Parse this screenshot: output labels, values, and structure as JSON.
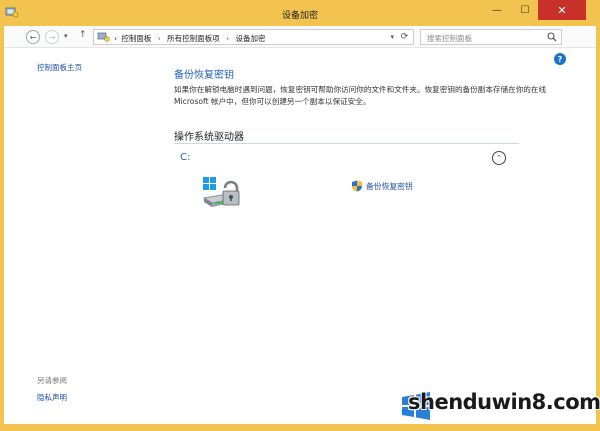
{
  "window": {
    "title": "设备加密",
    "minimize_glyph": "—",
    "maximize_glyph": "☐",
    "close_glyph": "✕"
  },
  "nav": {
    "back_glyph": "←",
    "forward_glyph": "→",
    "history_glyph": "▾",
    "up_glyph": "↑",
    "breadcrumbs": [
      "控制面板",
      "所有控制面板项",
      "设备加密"
    ],
    "crumb_separator": "›",
    "dropdown_glyph": "▾",
    "refresh_glyph": "⟳",
    "search_placeholder": "搜索控制面板"
  },
  "sidebar": {
    "home_link": "控制面板主页",
    "see_also_label": "另请参阅",
    "privacy_link": "隐私声明"
  },
  "main": {
    "help_glyph": "?",
    "title": "备份恢复密钥",
    "description": "如果你在解锁电脑时遇到问题，恢复密钥可帮助你访问你的文件和文件夹。恢复密钥的备份副本存储在你的在线 Microsoft 帐户中，但你可以创建另一个副本以保证安全。",
    "section_title": "操作系统驱动器",
    "drive_label": "C:",
    "collapse_glyph": "⌃",
    "backup_link": "备份恢复密钥"
  },
  "watermark": {
    "text": "shenduwin8.com"
  },
  "colors": {
    "title_bar": "#f2c44f",
    "close_button": "#c7312a",
    "link_blue": "#1f4fa8",
    "heading_blue": "#1f5fbf"
  }
}
